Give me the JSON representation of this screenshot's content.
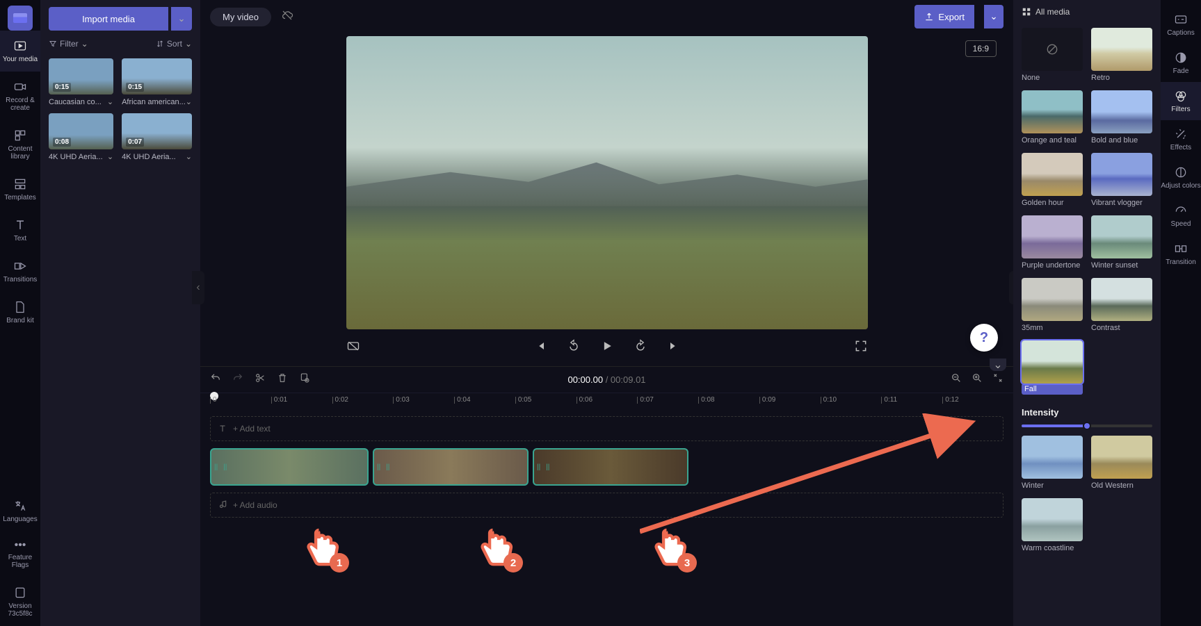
{
  "app": {
    "title": "My video",
    "aspect": "16:9"
  },
  "header": {
    "import": "Import media",
    "export": "Export"
  },
  "left_nav": {
    "items": [
      {
        "label": "Your media"
      },
      {
        "label": "Record & create"
      },
      {
        "label": "Content library"
      },
      {
        "label": "Templates"
      },
      {
        "label": "Text"
      },
      {
        "label": "Transitions"
      },
      {
        "label": "Brand kit"
      }
    ],
    "bottom": [
      {
        "label": "Languages"
      },
      {
        "label": "Feature Flags"
      },
      {
        "label": "Version 73c5f8c"
      }
    ]
  },
  "media_panel": {
    "filter_label": "Filter",
    "sort_label": "Sort",
    "clips": [
      {
        "dur": "0:15",
        "name": "Caucasian co..."
      },
      {
        "dur": "0:15",
        "name": "African american..."
      },
      {
        "dur": "0:08",
        "name": "4K UHD Aeria..."
      },
      {
        "dur": "0:07",
        "name": "4K UHD Aeria..."
      }
    ]
  },
  "playback": {
    "current": "00:00.00",
    "total": "00:09.01"
  },
  "ruler": {
    "ticks": [
      "0",
      "0:01",
      "0:02",
      "0:03",
      "0:04",
      "0:05",
      "0:06",
      "0:07",
      "0:08",
      "0:09",
      "0:10",
      "0:11",
      "0:12"
    ]
  },
  "tracks": {
    "text_placeholder": "+ Add text",
    "audio_placeholder": "+ Add audio"
  },
  "filters_panel": {
    "header": "All media",
    "intensity_label": "Intensity",
    "intensity_value": 50,
    "selected": "Fall",
    "list": [
      {
        "name": "None"
      },
      {
        "name": "Retro"
      },
      {
        "name": "Orange and teal"
      },
      {
        "name": "Bold and blue"
      },
      {
        "name": "Golden hour"
      },
      {
        "name": "Vibrant vlogger"
      },
      {
        "name": "Purple undertone"
      },
      {
        "name": "Winter sunset"
      },
      {
        "name": "35mm"
      },
      {
        "name": "Contrast"
      },
      {
        "name": "Fall"
      },
      {
        "name": "Winter"
      },
      {
        "name": "Old Western"
      },
      {
        "name": "Warm coastline"
      }
    ]
  },
  "right_nav": {
    "items": [
      {
        "label": "Captions"
      },
      {
        "label": "Fade"
      },
      {
        "label": "Filters"
      },
      {
        "label": "Effects"
      },
      {
        "label": "Adjust colors"
      },
      {
        "label": "Speed"
      },
      {
        "label": "Transition"
      }
    ]
  },
  "annotations": {
    "hand1": "1",
    "hand2": "2",
    "hand3": "3"
  },
  "help": {
    "symbol": "?"
  }
}
